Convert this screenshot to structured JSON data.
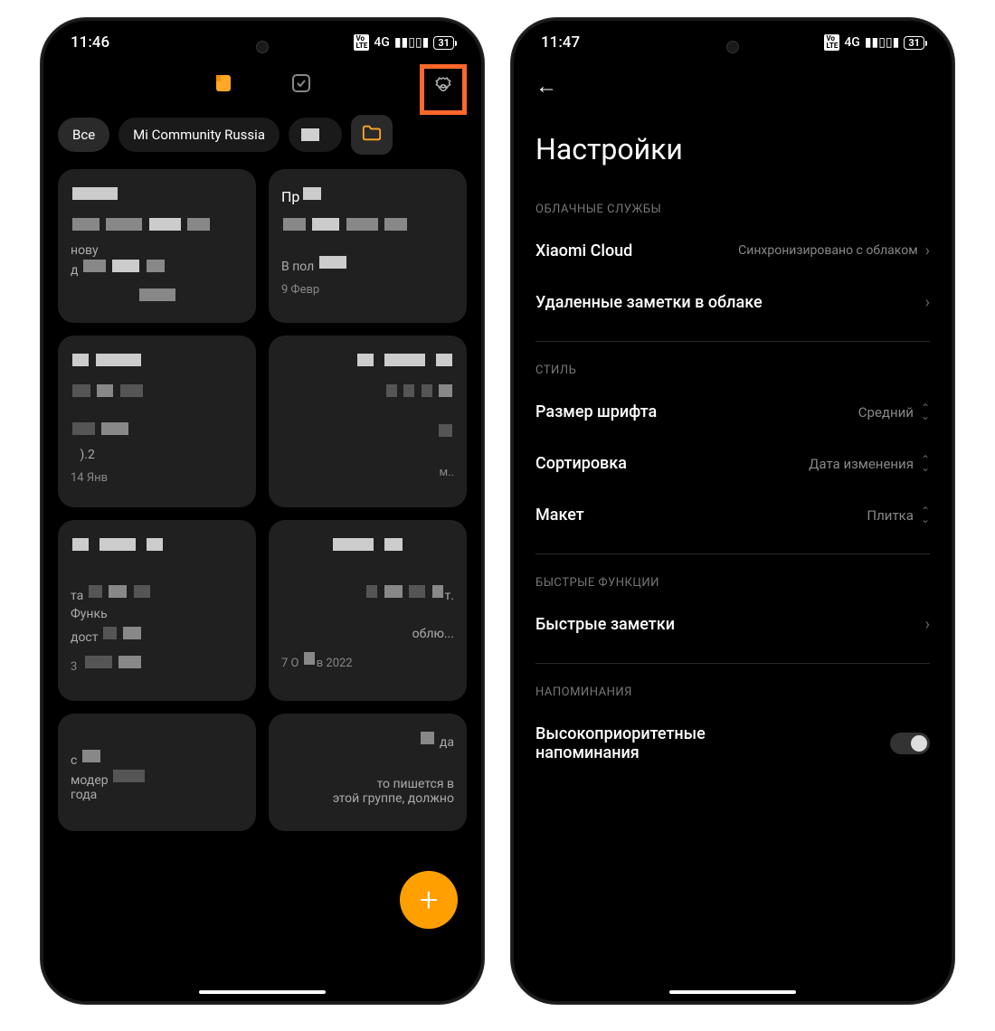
{
  "left": {
    "time": "11:46",
    "net": "4G",
    "batt": "31",
    "filters": {
      "all": "Все",
      "community": "Mi Community Russia"
    },
    "note_titles": {
      "n2": "Пр"
    },
    "note_text": {
      "n3a": "В пол",
      "n3b": "9 Февр",
      "n1a": "нову",
      "n1b": "д",
      "n4a": "14 Янв",
      "n5a": "та",
      "n5b": "Функь",
      "n5c": "дост",
      "n5d": "3",
      "n6a": "облю...",
      "n6b": "7 О",
      "n6c": "2022",
      "n7a": "да",
      "n8a": "с",
      "n8b": "модер",
      "n8c": "года",
      "n9a": "то пишется в",
      "n9b": "этой группе, должно"
    }
  },
  "right": {
    "time": "11:47",
    "net": "4G",
    "batt": "31",
    "title": "Настройки",
    "sections": {
      "cloud": "ОБЛАЧНЫЕ СЛУЖБЫ",
      "style": "СТИЛЬ",
      "quick": "БЫСТРЫЕ ФУНКЦИИ",
      "reminders": "НАПОМИНАНИЯ"
    },
    "items": {
      "xiaomi_cloud": "Xiaomi Cloud",
      "xiaomi_cloud_val": "Синхронизировано с облаком",
      "deleted": "Удаленные заметки в облаке",
      "font": "Размер шрифта",
      "font_val": "Средний",
      "sort": "Сортировка",
      "sort_val": "Дата изменения",
      "layout": "Макет",
      "layout_val": "Плитка",
      "quick_notes": "Быстрые заметки",
      "priority": "Высокоприоритетные напоминания"
    }
  }
}
